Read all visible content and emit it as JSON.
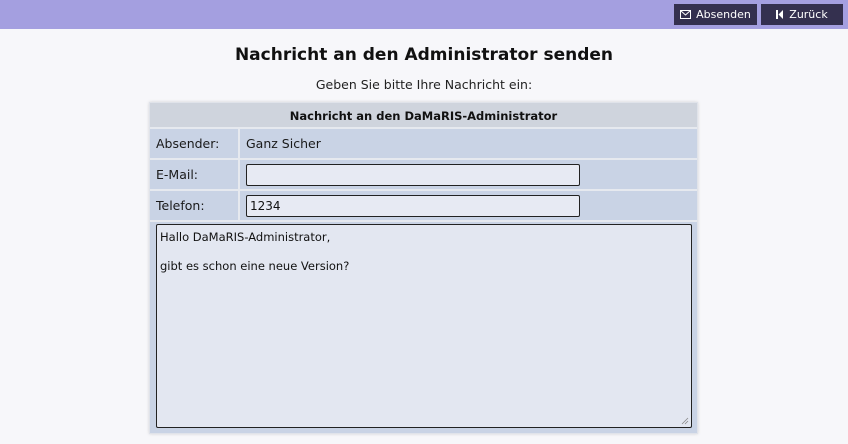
{
  "toolbar": {
    "send_label": "Absenden",
    "back_label": "Zurück",
    "bar_color": "#a49fe0",
    "button_color": "#34304f",
    "send_icon": "envelope-icon",
    "back_icon": "back-arrow-icon"
  },
  "page": {
    "title": "Nachricht an den Administrator senden",
    "subtitle": "Geben Sie bitte Ihre Nachricht ein:"
  },
  "form": {
    "header": "Nachricht an den DaMaRIS-Administrator",
    "sender_label": "Absender:",
    "sender_value": "Ganz Sicher",
    "email_label": "E-Mail:",
    "email_value": "",
    "phone_label": "Telefon:",
    "phone_value": "1234",
    "message": "Hallo DaMaRIS-Administrator,\n\ngibt es schon eine neue Version?"
  }
}
